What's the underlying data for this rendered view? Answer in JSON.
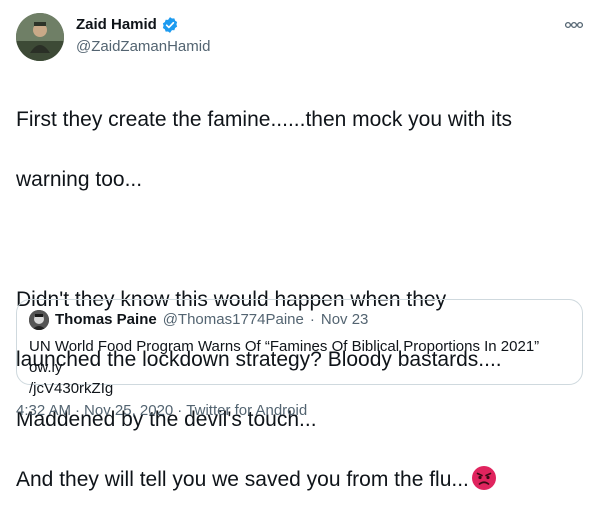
{
  "author": {
    "name": "Zaid Hamid",
    "handle": "@ZaidZamanHamid",
    "avatar_icon": "profile-photo",
    "verified_icon": "verified-badge-icon",
    "verified_color": "#1d9bf0"
  },
  "more_icon": "more-options-icon",
  "tweet": {
    "lines": [
      "First they create the famine......then mock you with its",
      "warning too...",
      "",
      "Didn't they know this would happen when they",
      "launched the lockdown strategy? Bloody bastards....",
      "Maddened by the devil's touch...",
      "And they will tell you we saved you from the flu..."
    ],
    "emoji": "angry-face-icon"
  },
  "quote": {
    "name": "Thomas Paine",
    "handle": "@Thomas1774Paine",
    "separator": "·",
    "date": "Nov 23",
    "text_line1": "UN World Food Program Warns Of “Famines Of Biblical Proportions In 2021” ow.ly",
    "text_line2": "/jcV430rkZIg"
  },
  "footer": {
    "time": "4:32 AM",
    "sep1": "·",
    "date": "Nov 25, 2020",
    "sep2": "·",
    "source": "Twitter for Android"
  },
  "colors": {
    "text": "#0f1419",
    "secondary": "#536471",
    "border": "#cfd9de",
    "accent": "#1d9bf0"
  }
}
